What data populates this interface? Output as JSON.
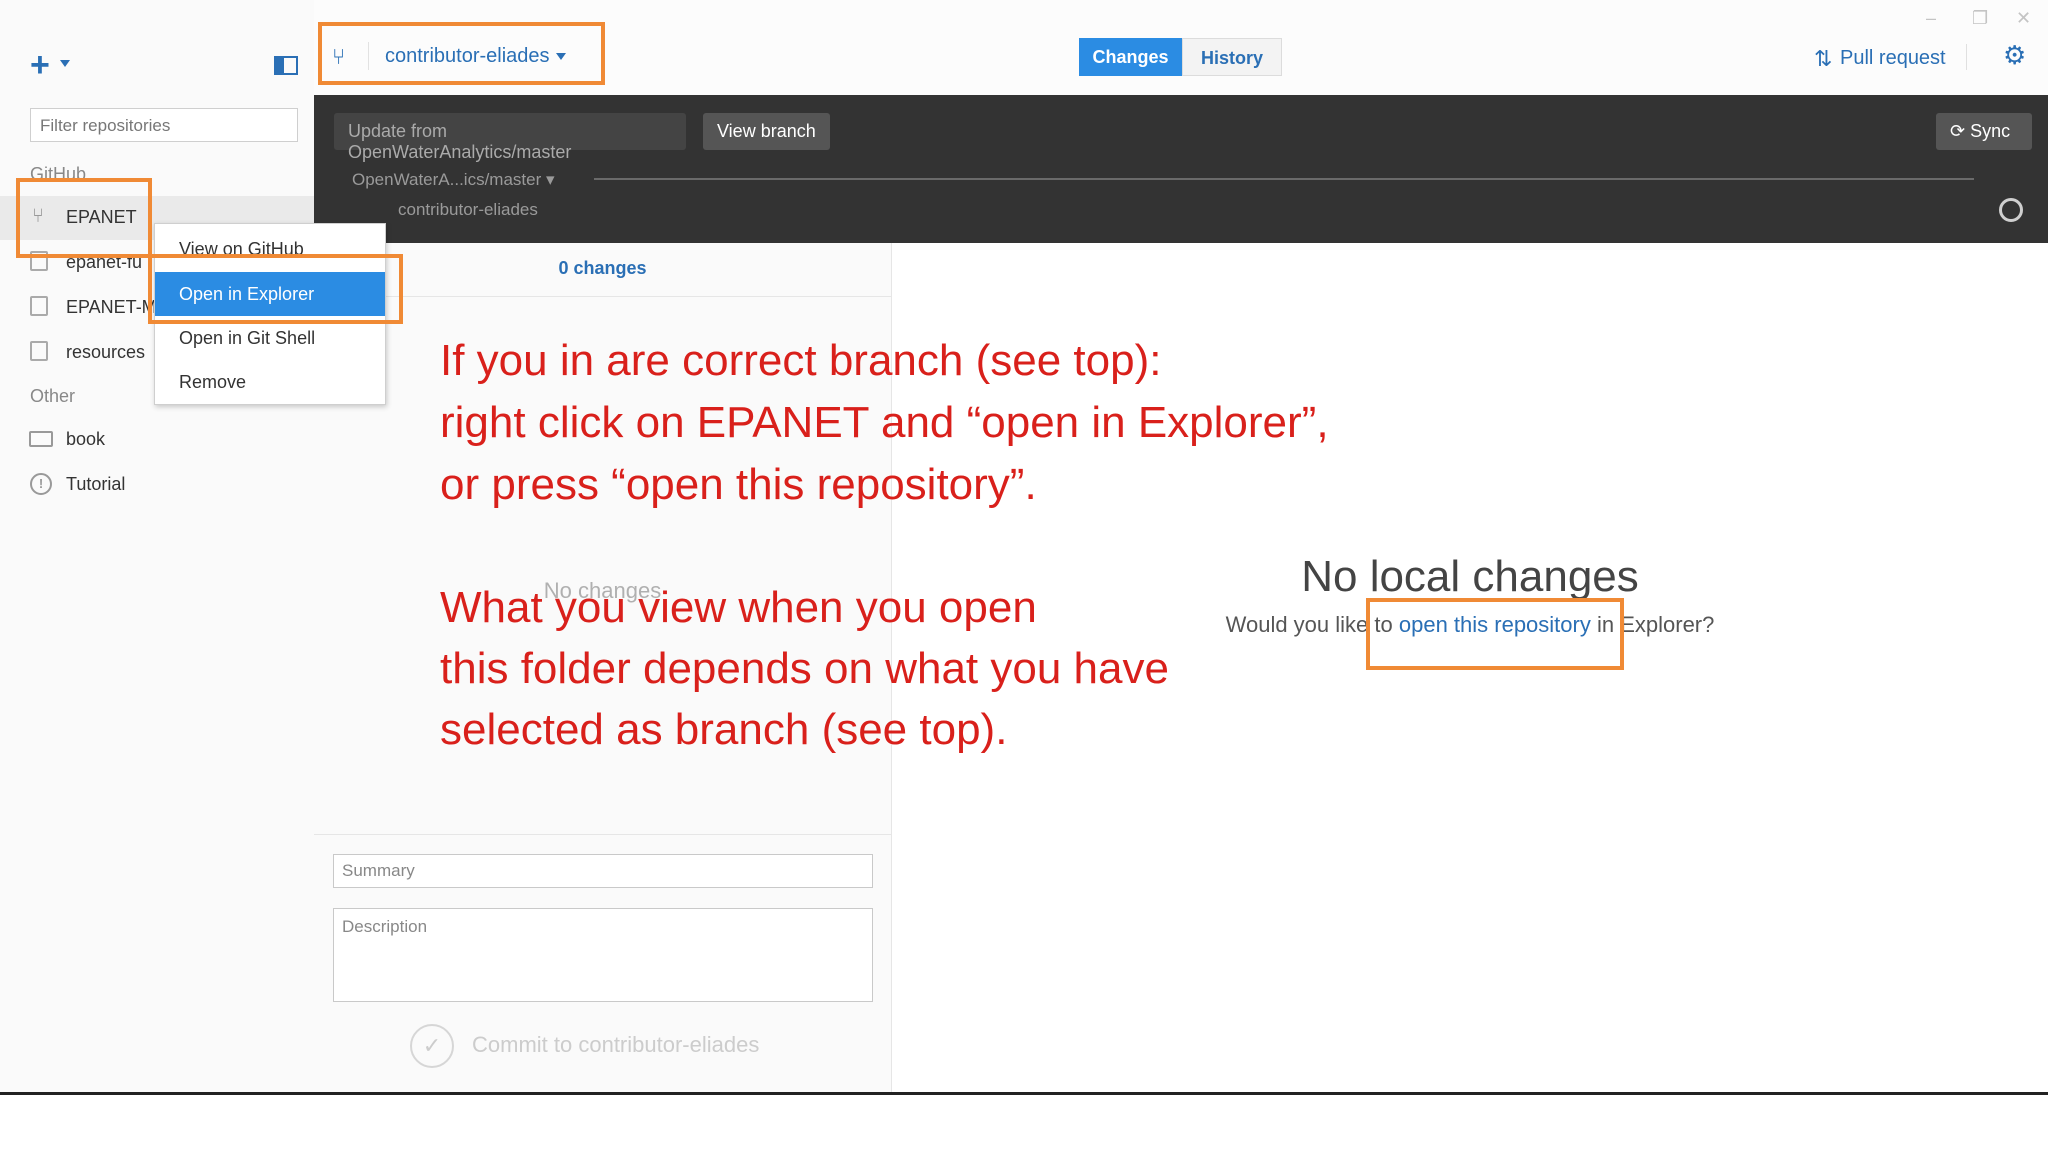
{
  "sidebar": {
    "filter_placeholder": "Filter repositories",
    "group_github": "GitHub",
    "group_other": "Other",
    "repos": [
      {
        "label": "EPANET"
      },
      {
        "label": "epanet-fu"
      },
      {
        "label": "EPANET-M"
      },
      {
        "label": "resources"
      },
      {
        "label": "book"
      },
      {
        "label": "Tutorial"
      }
    ]
  },
  "context_menu": {
    "items": [
      "View on GitHub",
      "Open in Explorer",
      "Open in Git Shell",
      "Remove"
    ]
  },
  "header": {
    "branch": "contributor-eliades",
    "tab_changes": "Changes",
    "tab_history": "History",
    "pull_request": "Pull request"
  },
  "branch_bar": {
    "update_btn": "Update from OpenWaterAnalytics/master",
    "view_btn": "View branch",
    "sync_btn": "Sync",
    "base_branch": "OpenWaterA...ics/master ▾",
    "compare_branch": "contributor-eliades"
  },
  "changes_panel": {
    "count": "0 changes",
    "no_changes": "No changes",
    "summary_placeholder": "Summary",
    "description_placeholder": "Description",
    "commit_label": "Commit to contributor-eliades"
  },
  "main": {
    "heading": "No local changes",
    "prompt_before": "Would you like to ",
    "prompt_link": "open this repository",
    "prompt_after": " in Explorer?"
  },
  "annotation": {
    "line1": "If you in are correct branch (see top):",
    "line2": "right click on EPANET and “open in Explorer”,",
    "line3": "or press “open this repository”.",
    "line4": "What you view when you open",
    "line5": "this folder depends on what you have",
    "line6": "selected as branch (see top)."
  },
  "colors": {
    "accent": "#2b8ce3",
    "annotation": "#d9201b",
    "highlight_box": "#f08a35",
    "dark_bar": "#333333"
  },
  "icons": [
    "plus-icon",
    "panel-toggle-icon",
    "branch-icon",
    "pull-request-icon",
    "gear-icon",
    "sync-icon",
    "fork-icon",
    "repo-icon",
    "monitor-icon",
    "info-icon",
    "check-icon"
  ]
}
